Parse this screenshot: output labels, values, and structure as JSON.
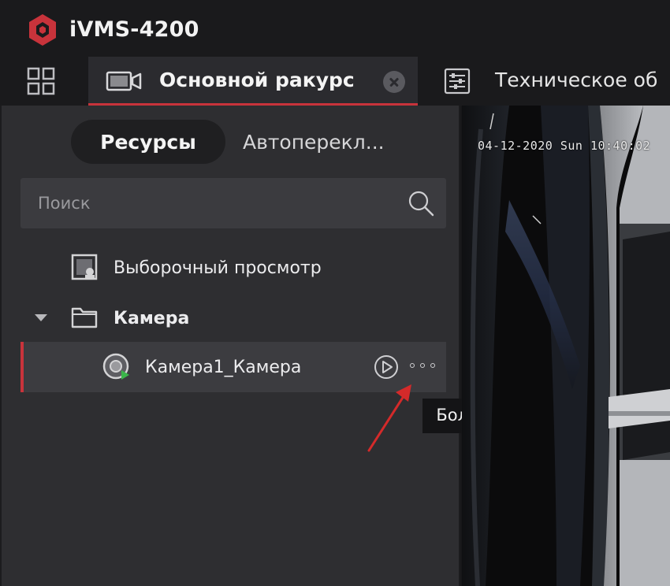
{
  "app": {
    "title": "iVMS-4200",
    "accent": "#c8333b"
  },
  "tabs": [
    {
      "label": "Основной ракурс",
      "icon": "video-camera-icon",
      "active": true
    },
    {
      "label": "Техническое об",
      "icon": "maintenance-icon",
      "active": false
    }
  ],
  "panel": {
    "subtabs": [
      {
        "label": "Ресурсы",
        "active": true
      },
      {
        "label": "Автоперекл...",
        "active": false
      }
    ],
    "search": {
      "placeholder": "Поиск",
      "value": ""
    },
    "tree": {
      "custom_view": "Выборочный просмотр",
      "group": {
        "label": "Камера",
        "expanded": true
      },
      "camera": {
        "label": "Камера1_Камера",
        "status": "online"
      }
    },
    "tooltip": "Больше"
  },
  "video": {
    "osd_timestamp": "04-12-2020 Sun  10:40:02"
  }
}
